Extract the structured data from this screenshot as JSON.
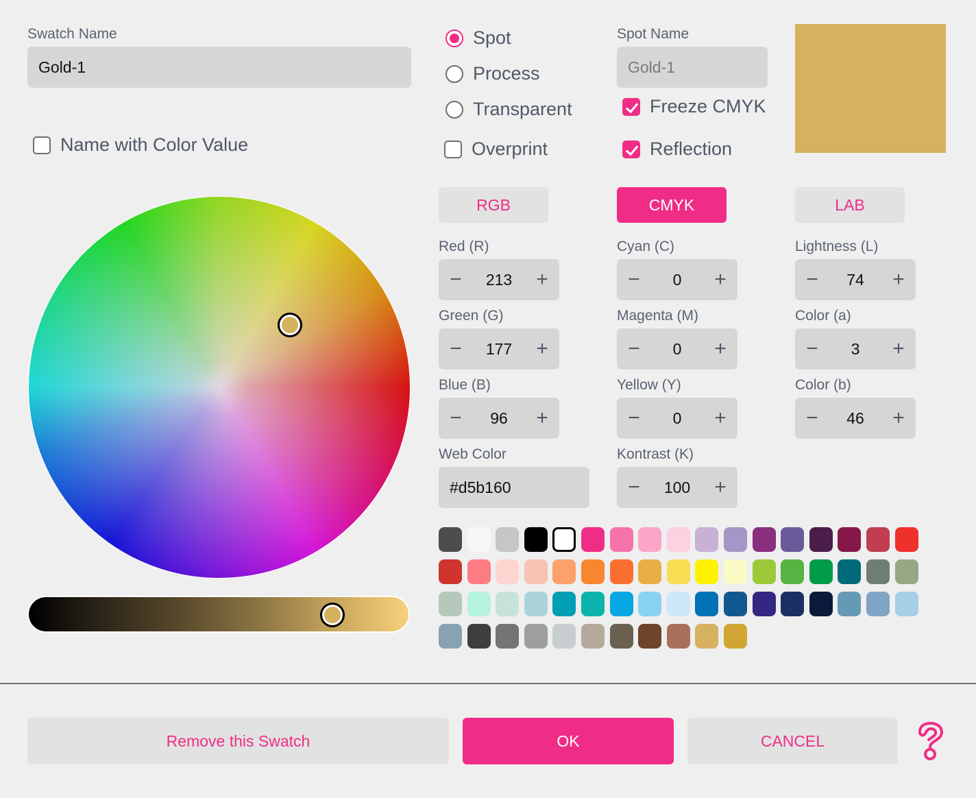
{
  "swatch_name": {
    "label": "Swatch Name",
    "value": "Gold-1"
  },
  "name_with_color_value": {
    "label": "Name with Color Value",
    "checked": false
  },
  "color_type": {
    "options": [
      {
        "label": "Spot",
        "selected": true
      },
      {
        "label": "Process",
        "selected": false
      },
      {
        "label": "Transparent",
        "selected": false
      }
    ]
  },
  "overprint": {
    "label": "Overprint",
    "checked": false
  },
  "spot_name": {
    "label": "Spot Name",
    "value": "Gold-1"
  },
  "freeze_cmyk": {
    "label": "Freeze CMYK",
    "checked": true
  },
  "reflection": {
    "label": "Reflection",
    "checked": true
  },
  "preview_color": "#d5b160",
  "accent_color": "#f02d86",
  "color_wheel": {
    "selected_color": "#d5b160"
  },
  "brightness_slider": {
    "value_fraction": 0.82
  },
  "modes": [
    {
      "label": "RGB",
      "active": false
    },
    {
      "label": "CMYK",
      "active": true
    },
    {
      "label": "LAB",
      "active": false
    }
  ],
  "rgb": [
    {
      "label": "Red (R)",
      "value": "213"
    },
    {
      "label": "Green (G)",
      "value": "177"
    },
    {
      "label": "Blue (B)",
      "value": "96"
    }
  ],
  "cmyk": [
    {
      "label": "Cyan (C)",
      "value": "0"
    },
    {
      "label": "Magenta (M)",
      "value": "0"
    },
    {
      "label": "Yellow (Y)",
      "value": "0"
    },
    {
      "label": "Kontrast (K)",
      "value": "100"
    }
  ],
  "lab": [
    {
      "label": "Lightness (L)",
      "value": "74"
    },
    {
      "label": "Color (a)",
      "value": "3"
    },
    {
      "label": "Color (b)",
      "value": "46"
    }
  ],
  "web_color": {
    "label": "Web Color",
    "value": "#d5b160"
  },
  "stepper_icons": {
    "minus": "−",
    "plus": "+"
  },
  "swatches": [
    [
      "#4d4d4f",
      "#f7f7f7",
      "#c6c6c6",
      "#000000",
      "#ffffff",
      "#f02d86",
      "#f672aa",
      "#fba6c8",
      "#fdd0e2",
      "#c9b0d6",
      "#a497c7",
      "#892f7d",
      "#6a5a9a",
      "#4b1d4a",
      "#861848",
      "#c13d50",
      "#f0302b"
    ],
    [
      "#d0342f",
      "#fd7c83",
      "#fed4d1",
      "#f8c3b3",
      "#fca16a",
      "#f88530",
      "#fa6f2f",
      "#e8af47",
      "#f7dd52",
      "#fff200",
      "#fbfbc6",
      "#9bc93a",
      "#55b442",
      "#009b48",
      "#006a7a",
      "#6e7f72",
      "#96a883"
    ],
    [
      "#b5c8ba",
      "#b5f3de",
      "#c7e3d9",
      "#acd3dc",
      "#009fb3",
      "#0bb5ad",
      "#06a6e2",
      "#8ad2f2",
      "#cbe9f8",
      "#0072b6",
      "#115891",
      "#332782",
      "#183063",
      "#0a1a3a",
      "#659ab4",
      "#7fa4c6",
      "#a6cee5"
    ],
    [
      "#88a2b2",
      "#3e3e3e",
      "#747474",
      "#9e9e9e",
      "#c8cdd0",
      "#b4aa9b",
      "#6b6050",
      "#6e452a",
      "#a8705a",
      "#d6b160",
      "#d0a534"
    ]
  ],
  "selected_swatch": {
    "row": 0,
    "col": 4
  },
  "footer": {
    "remove_label": "Remove this Swatch",
    "ok_label": "OK",
    "cancel_label": "CANCEL",
    "help_icon": "question-mark"
  }
}
